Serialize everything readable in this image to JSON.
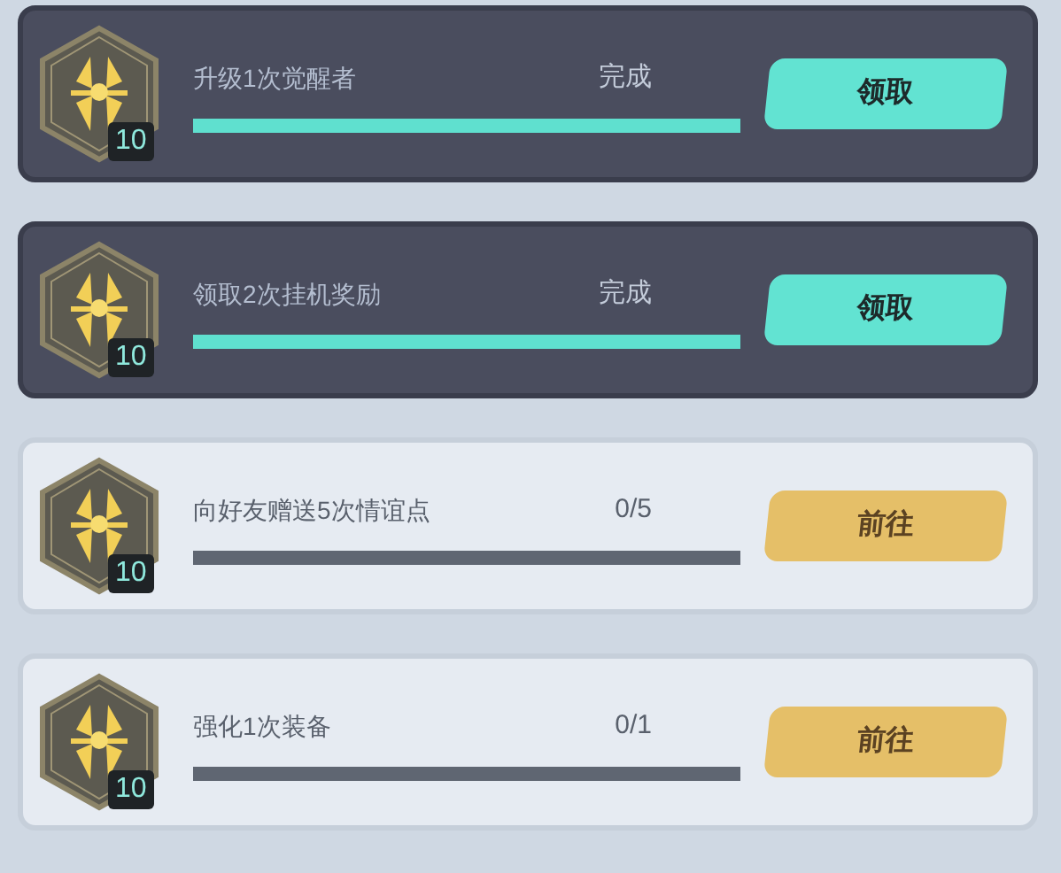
{
  "quests": [
    {
      "kind": "completed",
      "title": "升级1次觉醒者",
      "reward_count": "10",
      "progress_text": "完成",
      "level": 1,
      "button": "领取"
    },
    {
      "kind": "completed",
      "title": "领取2次挂机奖励",
      "reward_count": "10",
      "progress_text": "完成",
      "level": 1,
      "button": "领取"
    },
    {
      "kind": "pending",
      "title": "向好友赠送5次情谊点",
      "reward_count": "10",
      "progress_text": "0/5",
      "level": 0,
      "button": "前往"
    },
    {
      "kind": "pending",
      "title": "强化1次装备",
      "reward_count": "10",
      "progress_text": "0/1",
      "level": 0,
      "button": "前往"
    }
  ]
}
